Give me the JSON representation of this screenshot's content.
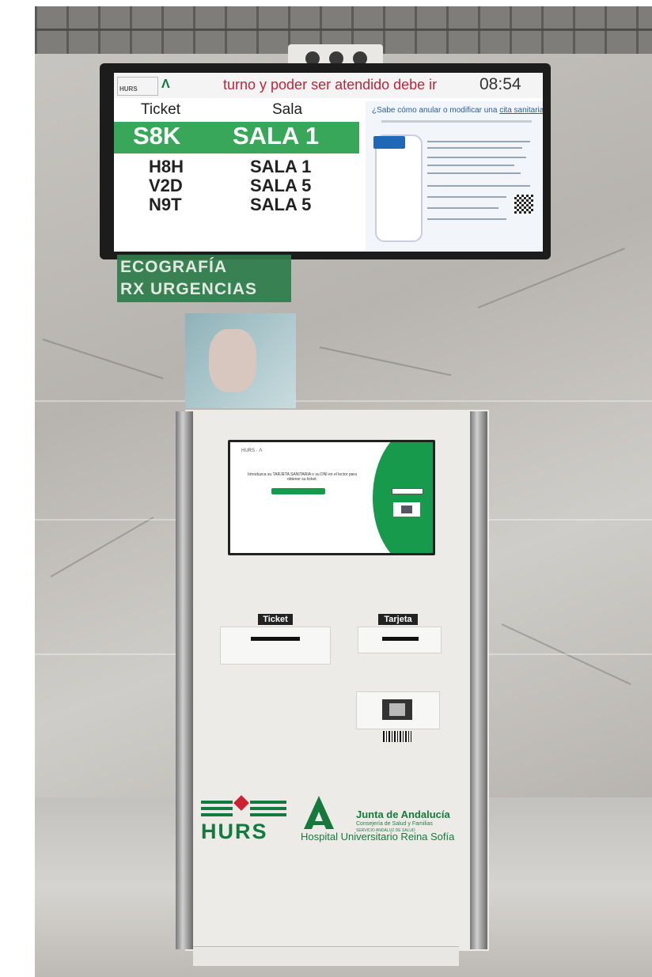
{
  "tv_display": {
    "ticker_text": "turno y poder ser atendido debe ir",
    "clock": "08:54",
    "header_left_logo": "HURS",
    "header_junta_logo": "Junta de Andalucía",
    "columns": {
      "ticket": "Ticket",
      "sala": "Sala"
    },
    "current_call": {
      "ticket": "S8K",
      "sala": "SALA 1"
    },
    "queue": [
      {
        "ticket": "H8H",
        "sala": "SALA 1"
      },
      {
        "ticket": "V2D",
        "sala": "SALA 5"
      },
      {
        "ticket": "N9T",
        "sala": "SALA 5"
      }
    ],
    "info_panel": {
      "title_prefix": "¿Sabe cómo anular o modificar una ",
      "title_link": "cita sanitaria",
      "title_suffix": "?"
    }
  },
  "signs": {
    "line1": "ECOGRAFÍA",
    "line2": "RX URGENCIAS"
  },
  "kiosk": {
    "screen_prompt": "Introduzca su TARJETA SANITARIA o su DNI en el lector para obtener su ticket.",
    "ticket_label": "Ticket",
    "card_label": "Tarjeta",
    "logos": {
      "hurs": "HURS",
      "junta_title": "Junta de Andalucía",
      "junta_sub": "Consejería de Salud y Familias",
      "junta_sub2": "SERVICIO ANDALUZ DE SALUD",
      "hospital": "Hospital Universitario Reina Sofía"
    }
  },
  "colors": {
    "green_highlight": "#38a759",
    "ticker_red": "#c0243c",
    "junta_green": "#16793c"
  }
}
